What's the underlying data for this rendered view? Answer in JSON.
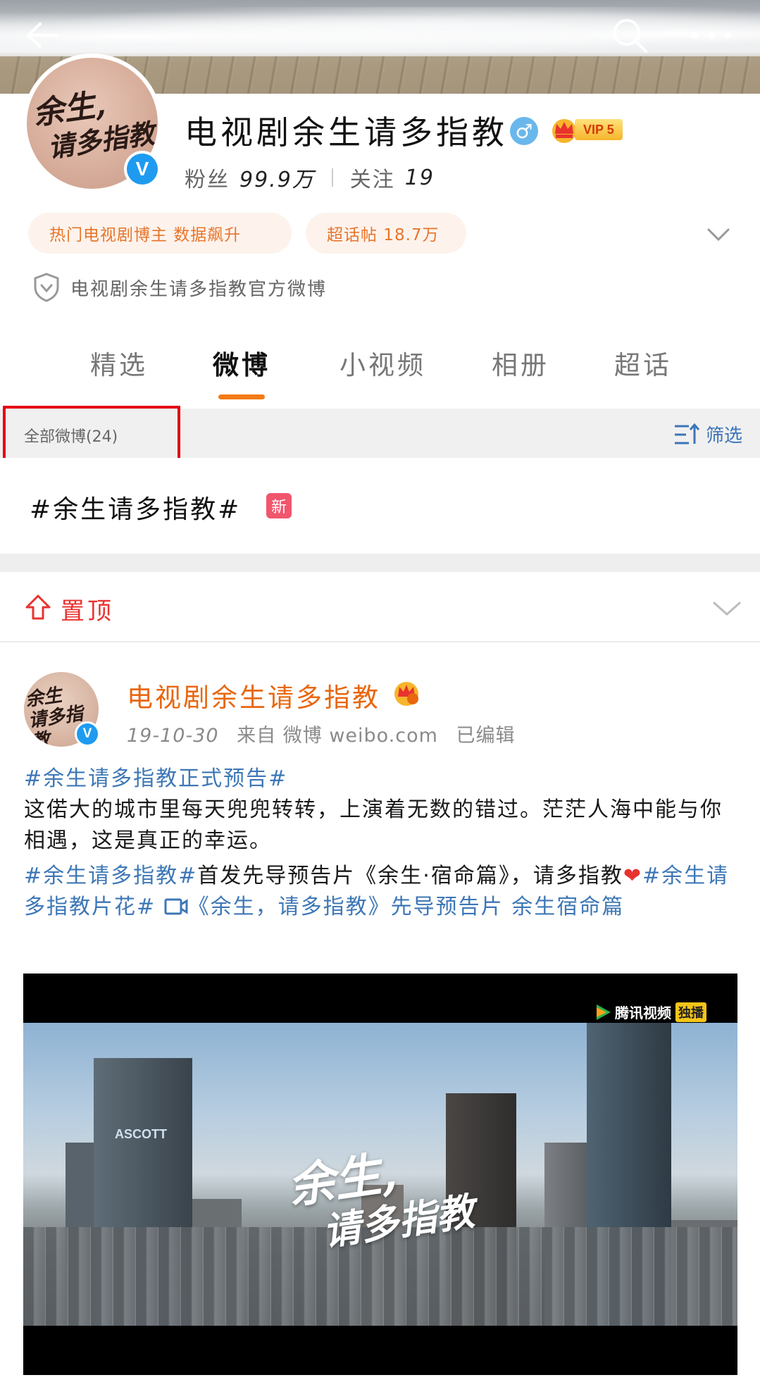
{
  "header": {
    "back_icon": "arrow-left-icon",
    "search_icon": "search-icon",
    "more_icon": "more-dots-icon"
  },
  "profile": {
    "name": "电视剧余生请多指教",
    "avatar_text_line1": "余生,",
    "avatar_text_line2": "请多指教",
    "vip_label": "VIP 5",
    "fans_label": "粉丝",
    "fans_count": "99.9万",
    "follow_label": "关注",
    "follow_count": "19",
    "tags": [
      "热门电视剧博主 数据飙升",
      "超话帖 18.7万"
    ],
    "official_text": "电视剧余生请多指教官方微博"
  },
  "tabs": [
    {
      "label": "精选",
      "active": false
    },
    {
      "label": "微博",
      "active": true
    },
    {
      "label": "小视频",
      "active": false
    },
    {
      "label": "相册",
      "active": false
    },
    {
      "label": "超话",
      "active": false
    }
  ],
  "filter_bar": {
    "title": "全部微博(24)",
    "filter_label": "筛选"
  },
  "topic": {
    "text": "#余生请多指教#",
    "new_badge": "新"
  },
  "pinned": {
    "label": "置顶"
  },
  "post": {
    "author": "电视剧余生请多指教",
    "date": "19-10-30",
    "source": "来自 微博 weibo.com",
    "edited": "已编辑",
    "avatar_text_line1": "余生",
    "avatar_text_line2": "请多指教",
    "tag1": "#余生请多指教正式预告#",
    "text1": "这偌大的城市里每天兜兜转转，上演着无数的错过。茫茫人海中能与你相遇，这是真正的幸运。",
    "tag2": "#余生请多指教#",
    "text2": "首发先导预告片《余生·宿命篇》，请多指教",
    "heart": "❤",
    "tag3": "#余生请多指教片花#",
    "video_link": "《余生，请多指教》先导预告片 余生宿命篇"
  },
  "video": {
    "title_line1": "余生,",
    "title_line2": "请多指教",
    "building_sign": "ASCOTT",
    "watermark": "腾讯视频",
    "watermark_tag": "独播"
  },
  "colors": {
    "accent_orange": "#f47a14",
    "link_blue": "#3d77b6",
    "pin_red": "#e8332f",
    "highlight_red": "#e60012"
  }
}
